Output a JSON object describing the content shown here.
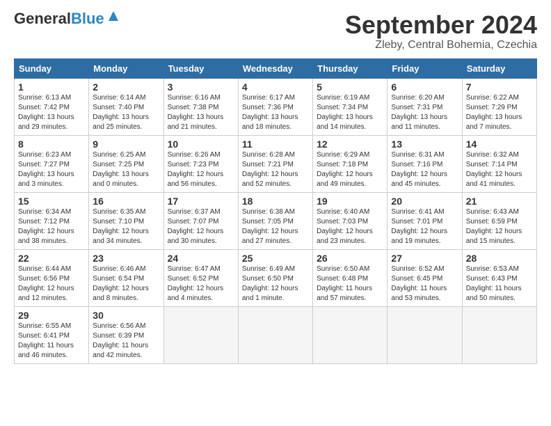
{
  "header": {
    "logo_general": "General",
    "logo_blue": "Blue",
    "month_title": "September 2024",
    "location": "Zleby, Central Bohemia, Czechia"
  },
  "weekdays": [
    "Sunday",
    "Monday",
    "Tuesday",
    "Wednesday",
    "Thursday",
    "Friday",
    "Saturday"
  ],
  "weeks": [
    [
      {
        "day": "1",
        "info": "Sunrise: 6:13 AM\nSunset: 7:42 PM\nDaylight: 13 hours\nand 29 minutes."
      },
      {
        "day": "2",
        "info": "Sunrise: 6:14 AM\nSunset: 7:40 PM\nDaylight: 13 hours\nand 25 minutes."
      },
      {
        "day": "3",
        "info": "Sunrise: 6:16 AM\nSunset: 7:38 PM\nDaylight: 13 hours\nand 21 minutes."
      },
      {
        "day": "4",
        "info": "Sunrise: 6:17 AM\nSunset: 7:36 PM\nDaylight: 13 hours\nand 18 minutes."
      },
      {
        "day": "5",
        "info": "Sunrise: 6:19 AM\nSunset: 7:34 PM\nDaylight: 13 hours\nand 14 minutes."
      },
      {
        "day": "6",
        "info": "Sunrise: 6:20 AM\nSunset: 7:31 PM\nDaylight: 13 hours\nand 11 minutes."
      },
      {
        "day": "7",
        "info": "Sunrise: 6:22 AM\nSunset: 7:29 PM\nDaylight: 13 hours\nand 7 minutes."
      }
    ],
    [
      {
        "day": "8",
        "info": "Sunrise: 6:23 AM\nSunset: 7:27 PM\nDaylight: 13 hours\nand 3 minutes."
      },
      {
        "day": "9",
        "info": "Sunrise: 6:25 AM\nSunset: 7:25 PM\nDaylight: 13 hours\nand 0 minutes."
      },
      {
        "day": "10",
        "info": "Sunrise: 6:26 AM\nSunset: 7:23 PM\nDaylight: 12 hours\nand 56 minutes."
      },
      {
        "day": "11",
        "info": "Sunrise: 6:28 AM\nSunset: 7:21 PM\nDaylight: 12 hours\nand 52 minutes."
      },
      {
        "day": "12",
        "info": "Sunrise: 6:29 AM\nSunset: 7:18 PM\nDaylight: 12 hours\nand 49 minutes."
      },
      {
        "day": "13",
        "info": "Sunrise: 6:31 AM\nSunset: 7:16 PM\nDaylight: 12 hours\nand 45 minutes."
      },
      {
        "day": "14",
        "info": "Sunrise: 6:32 AM\nSunset: 7:14 PM\nDaylight: 12 hours\nand 41 minutes."
      }
    ],
    [
      {
        "day": "15",
        "info": "Sunrise: 6:34 AM\nSunset: 7:12 PM\nDaylight: 12 hours\nand 38 minutes."
      },
      {
        "day": "16",
        "info": "Sunrise: 6:35 AM\nSunset: 7:10 PM\nDaylight: 12 hours\nand 34 minutes."
      },
      {
        "day": "17",
        "info": "Sunrise: 6:37 AM\nSunset: 7:07 PM\nDaylight: 12 hours\nand 30 minutes."
      },
      {
        "day": "18",
        "info": "Sunrise: 6:38 AM\nSunset: 7:05 PM\nDaylight: 12 hours\nand 27 minutes."
      },
      {
        "day": "19",
        "info": "Sunrise: 6:40 AM\nSunset: 7:03 PM\nDaylight: 12 hours\nand 23 minutes."
      },
      {
        "day": "20",
        "info": "Sunrise: 6:41 AM\nSunset: 7:01 PM\nDaylight: 12 hours\nand 19 minutes."
      },
      {
        "day": "21",
        "info": "Sunrise: 6:43 AM\nSunset: 6:59 PM\nDaylight: 12 hours\nand 15 minutes."
      }
    ],
    [
      {
        "day": "22",
        "info": "Sunrise: 6:44 AM\nSunset: 6:56 PM\nDaylight: 12 hours\nand 12 minutes."
      },
      {
        "day": "23",
        "info": "Sunrise: 6:46 AM\nSunset: 6:54 PM\nDaylight: 12 hours\nand 8 minutes."
      },
      {
        "day": "24",
        "info": "Sunrise: 6:47 AM\nSunset: 6:52 PM\nDaylight: 12 hours\nand 4 minutes."
      },
      {
        "day": "25",
        "info": "Sunrise: 6:49 AM\nSunset: 6:50 PM\nDaylight: 12 hours\nand 1 minute."
      },
      {
        "day": "26",
        "info": "Sunrise: 6:50 AM\nSunset: 6:48 PM\nDaylight: 11 hours\nand 57 minutes."
      },
      {
        "day": "27",
        "info": "Sunrise: 6:52 AM\nSunset: 6:45 PM\nDaylight: 11 hours\nand 53 minutes."
      },
      {
        "day": "28",
        "info": "Sunrise: 6:53 AM\nSunset: 6:43 PM\nDaylight: 11 hours\nand 50 minutes."
      }
    ],
    [
      {
        "day": "29",
        "info": "Sunrise: 6:55 AM\nSunset: 6:41 PM\nDaylight: 11 hours\nand 46 minutes."
      },
      {
        "day": "30",
        "info": "Sunrise: 6:56 AM\nSunset: 6:39 PM\nDaylight: 11 hours\nand 42 minutes."
      },
      {
        "day": "",
        "info": ""
      },
      {
        "day": "",
        "info": ""
      },
      {
        "day": "",
        "info": ""
      },
      {
        "day": "",
        "info": ""
      },
      {
        "day": "",
        "info": ""
      }
    ]
  ]
}
